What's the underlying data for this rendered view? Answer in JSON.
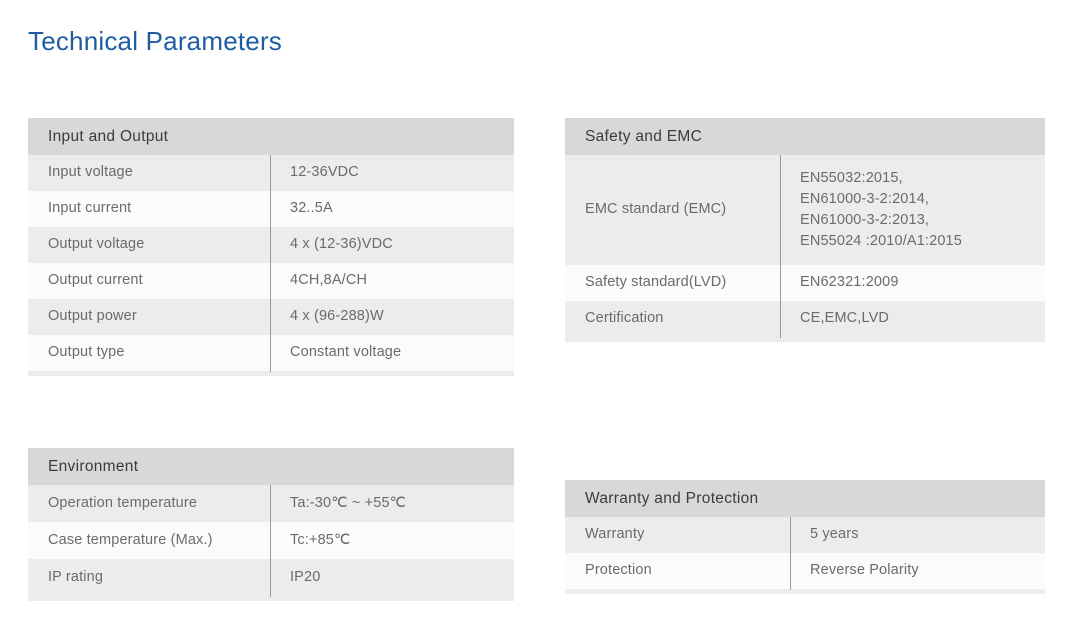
{
  "page": {
    "title": "Technical Parameters",
    "title_color": "#1f5da3",
    "header_band_color": "#d8d8d8",
    "row_odd_color": "#ececec",
    "row_even_color": "#fbfbfb",
    "divider_color": "#9a9a9a",
    "text_color": "#6b6b6b"
  },
  "tables": {
    "input_output": {
      "header": "Input and Output",
      "rows": [
        {
          "label": "Input voltage",
          "value": "12-36VDC"
        },
        {
          "label": "Input current",
          "value": "32..5A"
        },
        {
          "label": "Output voltage",
          "value": "4 x (12-36)VDC"
        },
        {
          "label": "Output current",
          "value": "4CH,8A/CH"
        },
        {
          "label": "Output power",
          "value": "4 x (96-288)W"
        },
        {
          "label": "Output type",
          "value": "Constant voltage"
        }
      ]
    },
    "safety_emc": {
      "header": "Safety and EMC",
      "rows": [
        {
          "label": "EMC standard (EMC)",
          "value": "EN55032:2015,\nEN61000-3-2:2014,\nEN61000-3-2:2013,\nEN55024 :2010/A1:2015"
        },
        {
          "label": "Safety standard(LVD)",
          "value": "EN62321:2009"
        },
        {
          "label": "Certification",
          "value": "CE,EMC,LVD"
        }
      ]
    },
    "environment": {
      "header": "Environment",
      "rows": [
        {
          "label": "Operation temperature",
          "value": "Ta:-30℃ ~ +55℃"
        },
        {
          "label": "Case temperature (Max.)",
          "value": "Tc:+85℃"
        },
        {
          "label": "IP rating",
          "value": "IP20"
        }
      ]
    },
    "warranty_protection": {
      "header": "Warranty and Protection",
      "rows": [
        {
          "label": "Warranty",
          "value": "5 years"
        },
        {
          "label": "Protection",
          "value": "Reverse Polarity"
        }
      ]
    }
  }
}
